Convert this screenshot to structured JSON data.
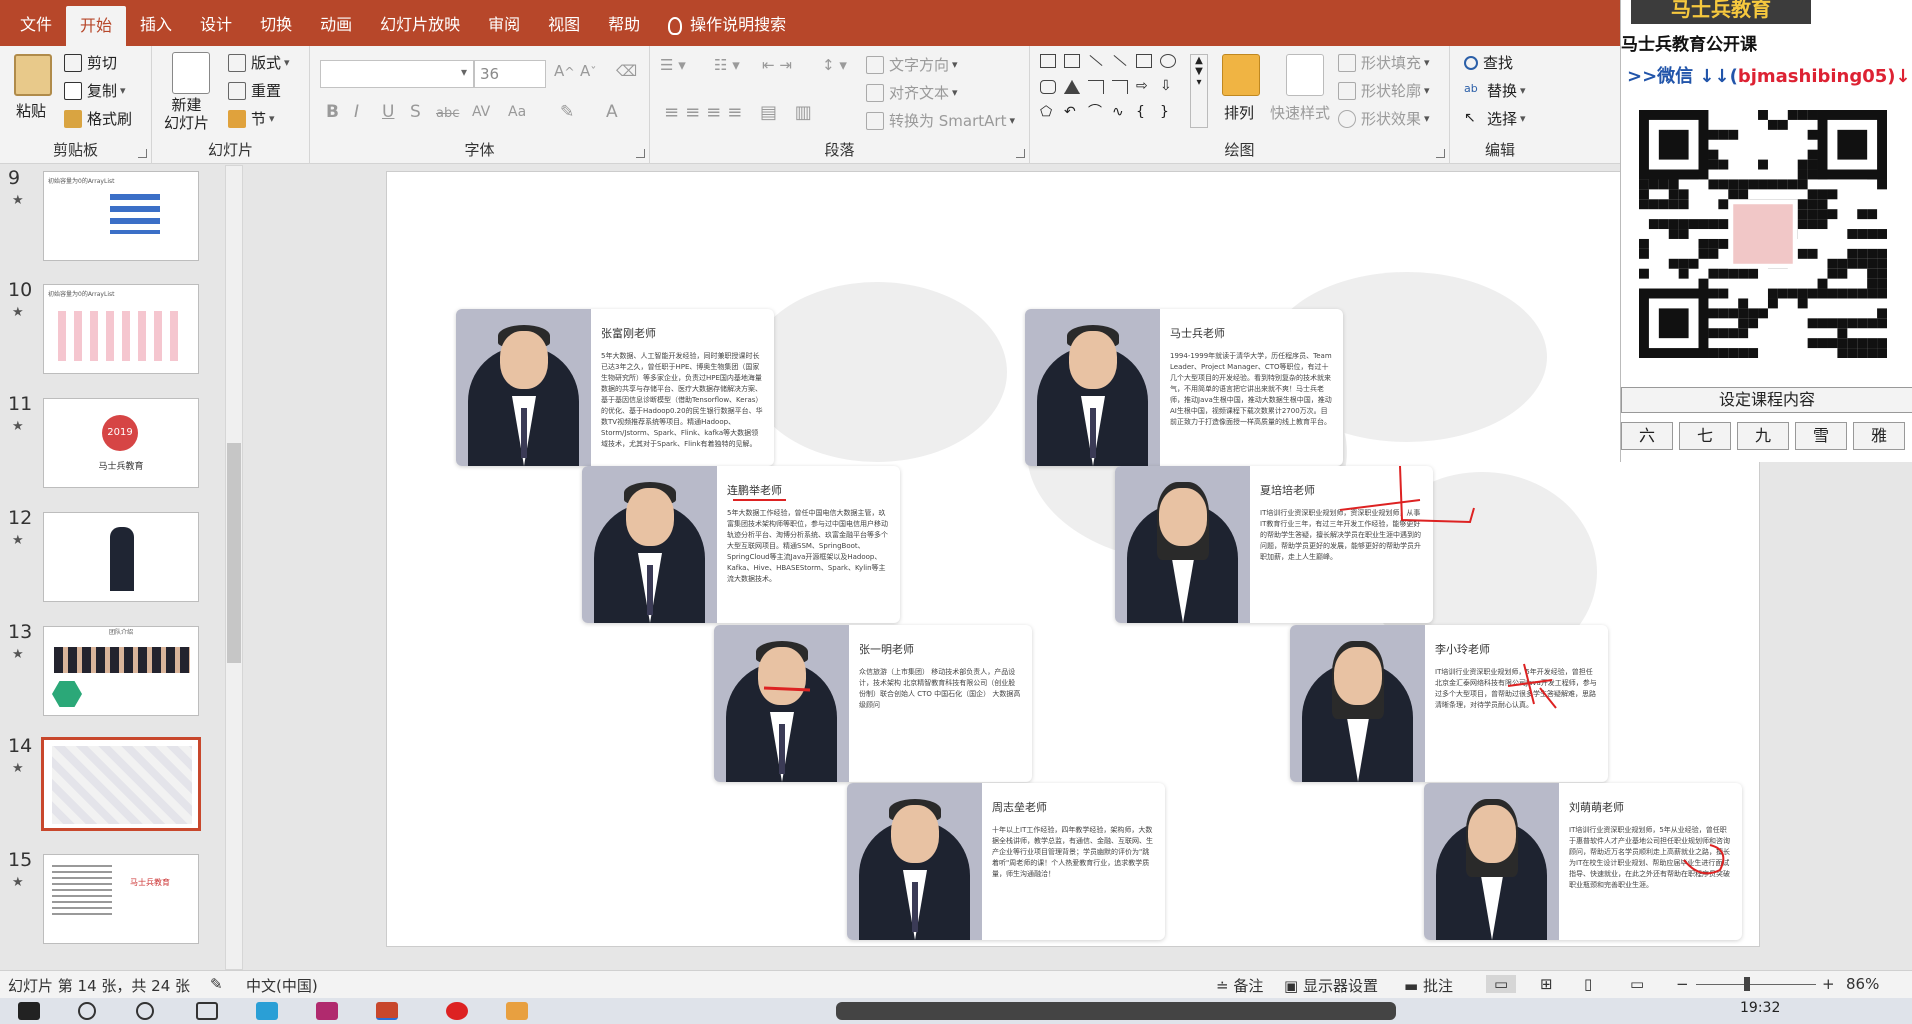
{
  "menu": {
    "tabs": [
      "文件",
      "开始",
      "插入",
      "设计",
      "切换",
      "动画",
      "幻灯片放映",
      "审阅",
      "视图",
      "帮助"
    ],
    "active": "开始",
    "tell_me": "操作说明搜索"
  },
  "ribbon": {
    "clipboard": {
      "label": "剪贴板",
      "paste": "粘贴",
      "cut": "剪切",
      "copy": "复制",
      "format_painter": "格式刷"
    },
    "slides": {
      "label": "幻灯片",
      "new_slide": "新建\n幻灯片",
      "layout": "版式",
      "reset": "重置",
      "section": "节"
    },
    "font": {
      "label": "字体",
      "font_size": "36",
      "buttons": [
        "B",
        "I",
        "U",
        "S",
        "abc",
        "AV",
        "Aa",
        "A"
      ]
    },
    "paragraph": {
      "label": "段落",
      "text_direction": "文字方向",
      "align_text": "对齐文本",
      "convert_smartart": "转换为 SmartArt"
    },
    "drawing": {
      "label": "绘图",
      "arrange": "排列",
      "quick_styles": "快速样式",
      "shape_fill": "形状填充",
      "shape_outline": "形状轮廓",
      "shape_effects": "形状效果"
    },
    "editing": {
      "label": "编辑",
      "find": "查找",
      "replace": "替换",
      "select": "选择"
    }
  },
  "thumbnails": [
    {
      "num": "9",
      "title": "初始容量为0的ArrayList"
    },
    {
      "num": "10",
      "title": "初始容量为0的ArrayList"
    },
    {
      "num": "11",
      "title": "马士兵教育",
      "year": "2019"
    },
    {
      "num": "12",
      "title": ""
    },
    {
      "num": "13",
      "title": "团队介绍"
    },
    {
      "num": "14",
      "title": ""
    },
    {
      "num": "15",
      "title": "马士兵教育"
    }
  ],
  "selected_slide": "14",
  "teachers": [
    {
      "name": "张富刚老师",
      "desc": "5年大数据、人工智能开发经验，同时兼职授课时长已达3年之久，曾任职于HPE、博奥生物集团（国家生物研究所）等多家企业，负责过HPE国内基地海量数据的共享与存储平台、医疗大数据存储解决方案、基于基因信息诊断模型（借助Tensorflow、Keras）的优化、基于Hadoop0.20的民生银行数据平台、华数TV视频推荐系统等项目。精通Hadoop、Storm/Jstorm、Spark、Flink、kafka等大数据领域技术，尤其对于Spark、Flink有着独特的见解。"
    },
    {
      "name": "连鹏举老师",
      "desc": "5年大数据工作经验，曾任中国电信大数据主管，玖富集团技术架构师等职位，参与过中国电信用户移动轨迹分析平台、淘博分析系统、玖富金融平台等多个大型互联网项目。精通SSM、SpringBoot、SpringCloud等主流Java开源框架以及Hadoop、Kafka、Hive、HBASEStorm、Spark、Kylin等主流大数据技术。"
    },
    {
      "name": "张一明老师",
      "desc": "众信旅游（上市集团） 移动技术部负责人，产品设计，技术架构  北京精智教育科技有限公司（创业股份制）联合创始人 CTO 中国石化（国企） 大数据高级顾问"
    },
    {
      "name": "周志垒老师",
      "desc": "十年以上IT工作经验，四年教学经验，架构师，大数据全栈讲师，教学总监，有通信、金融、互联网、生产企业等行业项目管理背景；学员幽默的评价为\"跳着听\"周老师的课！个人热爱教育行业，追求教学质量，师生沟通融洽！"
    },
    {
      "name": "马士兵老师",
      "desc": "1994-1999年就读于清华大学，历任程序员、Team Leader、Project Manager、CTO等职位，有过十几个大型项目的开发经验。看到特别复杂的技术就来气，不用简单的语言把它讲出来就不爽！马士兵老师，推动Java生根中国，推动大数据生根中国，推动AI生根中国，视频课程下载次数累计2700万次。目前正致力于打造像面授一样高质量的线上教育平台。"
    },
    {
      "name": "夏培培老师",
      "desc": "IT培训行业资深职业规划师，资深职业规划师，从事IT教育行业三年，有过三年开发工作经验，能够更好的帮助学生答疑，擅长解决学员在职业生涯中遇到的问题，帮助学员更好的发展，能够更好的帮助学员升职加薪，走上人生巅峰。"
    },
    {
      "name": "李小玲老师",
      "desc": "IT培训行业资深职业规划师，5年开发经验，曾担任北京金汇泰网络科技有限公司Java开发工程师，参与过多个大型项目，曾帮助过很多学生答疑解难，思路清晰条理，对待学员耐心认真。"
    },
    {
      "name": "刘萌萌老师",
      "desc": "IT培训行业资深职业规划师，5年从业经验，曾任职于惠普软件人才产业基地公司担任职业规划师和咨询顾问，帮助近万名学员顺利走上高薪就业之路，擅长为IT在校生设计职业规划、帮助应届毕业生进行面试指导、快速就业，在此之外还有帮助在职程序员突破职业瓶颈和完善职业生涯。"
    }
  ],
  "status": {
    "slide_info": "幻灯片 第 14 张，共 24 张",
    "language": "中文(中国)",
    "notes": "备注",
    "display_settings": "显示器设置",
    "comments": "批注",
    "zoom": "86%"
  },
  "overlay": {
    "brand": "马士兵教育",
    "title": "马士兵教育公开课",
    "wechat_prefix": ">>微信 ↓↓(",
    "wechat_id": "bjmashibing05",
    "wechat_suffix": ")↓↓",
    "button": "设定课程内容",
    "keys": [
      "六",
      "七",
      "九",
      "雪",
      "雅"
    ]
  },
  "taskbar": {
    "time": "19:32"
  }
}
